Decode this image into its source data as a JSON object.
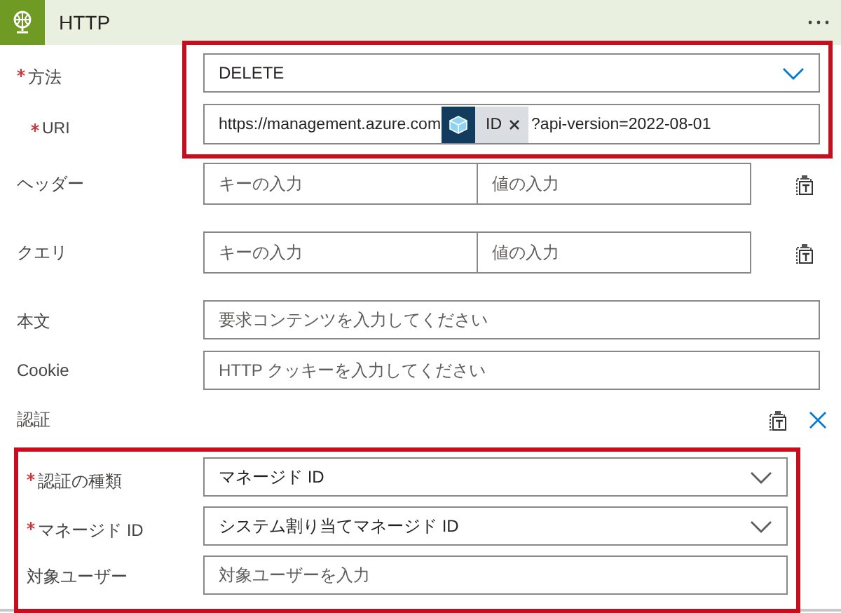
{
  "header": {
    "title": "HTTP"
  },
  "groups": [
    {
      "highlighted": true,
      "rows": [
        {
          "kind": "dropdown",
          "label": "方法",
          "required": true,
          "value": "DELETE"
        },
        {
          "kind": "uri",
          "label": "URI",
          "required": true,
          "prefix": "https://management.azure.com",
          "token": "ID",
          "suffix": "?api-version=2022-08-01"
        }
      ]
    },
    {
      "rows": [
        {
          "kind": "pair",
          "label": "ヘッダー",
          "required": false,
          "key_placeholder": "キーの入力",
          "value_placeholder": "値の入力"
        },
        {
          "kind": "pair",
          "label": "クエリ",
          "required": false,
          "key_placeholder": "キーの入力",
          "value_placeholder": "値の入力"
        },
        {
          "kind": "text",
          "label": "本文",
          "required": false,
          "placeholder": "要求コンテンツを入力してください"
        },
        {
          "kind": "text",
          "label": "Cookie",
          "required": false,
          "placeholder": "HTTP クッキーを入力してください"
        }
      ]
    },
    {
      "title": "認証",
      "highlighted": true,
      "rows": [
        {
          "kind": "dropdown",
          "label": "認証の種類",
          "required": true,
          "value": "マネージド ID"
        },
        {
          "kind": "dropdown",
          "label": "マネージド ID",
          "required": true,
          "value": "システム割り当てマネージド ID"
        },
        {
          "kind": "text",
          "label": "対象ユーザー",
          "required": false,
          "placeholder": "対象ユーザーを入力"
        }
      ]
    }
  ]
}
